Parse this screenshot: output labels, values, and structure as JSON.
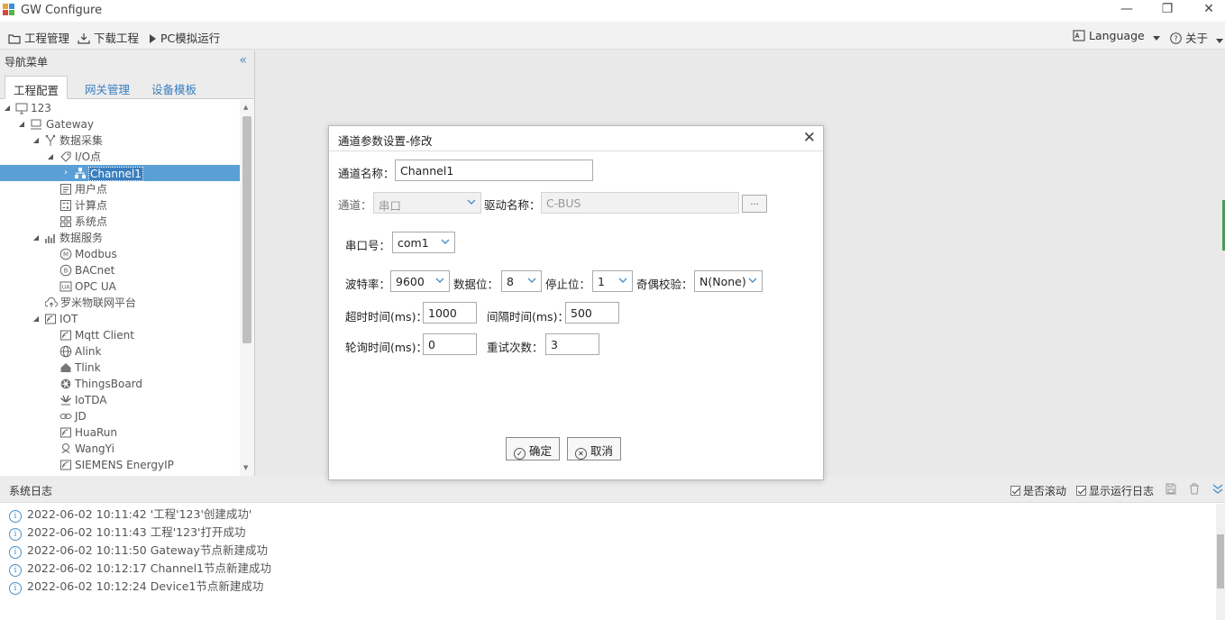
{
  "window": {
    "title": "GW Configure",
    "minimize": "—",
    "restore": "❐",
    "close": "✕"
  },
  "toolbar": {
    "project": "工程管理",
    "download": "下载工程",
    "simulate": "PC模拟运行",
    "language": "Language",
    "about": "关于"
  },
  "nav": {
    "title": "导航菜单",
    "collapse": "«",
    "tabs": [
      "工程配置",
      "网关管理",
      "设备模板"
    ],
    "tree": [
      "123",
      "Gateway",
      "数据采集",
      "I/O点",
      "Channel1",
      "用户点",
      "计算点",
      "系统点",
      "数据服务",
      "Modbus",
      "BACnet",
      "OPC UA",
      "罗米物联网平台",
      "IOT",
      "Mqtt Client",
      "Alink",
      "Tlink",
      "ThingsBoard",
      "IoTDA",
      "JD",
      "HuaRun",
      "WangYi",
      "SIEMENS EnergyIP"
    ]
  },
  "dialog": {
    "title": "通道参数设置-修改",
    "close": "✕",
    "channel_name_label": "通道名称：",
    "channel_name_value": "Channel1",
    "channel_label": "通道：",
    "channel_value": "串口",
    "driver_label": "驱动名称：",
    "driver_value": "C-BUS",
    "dots": "...",
    "port_label": "串口号：",
    "port_value": "com1",
    "baud_label": "波特率：",
    "baud_value": "9600",
    "databits_label": "数据位：",
    "databits_value": "8",
    "stopbits_label": "停止位：",
    "stopbits_value": "1",
    "parity_label": "奇偶校验：",
    "parity_value": "N(None)",
    "timeout_label": "超时时间(ms)：",
    "timeout_value": "1000",
    "interval_label": "间隔时间(ms)：",
    "interval_value": "500",
    "poll_label": "轮询时间(ms)：",
    "poll_value": "0",
    "retry_label": "重试次数：",
    "retry_value": "3",
    "ok": "确定",
    "cancel": "取消"
  },
  "log": {
    "title": "系统日志",
    "autoscroll": "是否滚动",
    "show_run_log": "显示运行日志",
    "lines": [
      "2022-06-02 10:11:42 '工程'123'创建成功'",
      "2022-06-02 10:11:43 工程'123'打开成功",
      "2022-06-02 10:11:50 Gateway节点新建成功",
      "2022-06-02 10:12:17 Channel1节点新建成功",
      "2022-06-02 10:12:24 Device1节点新建成功"
    ]
  },
  "colors": {
    "accent": "#4a90c9",
    "selection": "#5aa0d6"
  }
}
